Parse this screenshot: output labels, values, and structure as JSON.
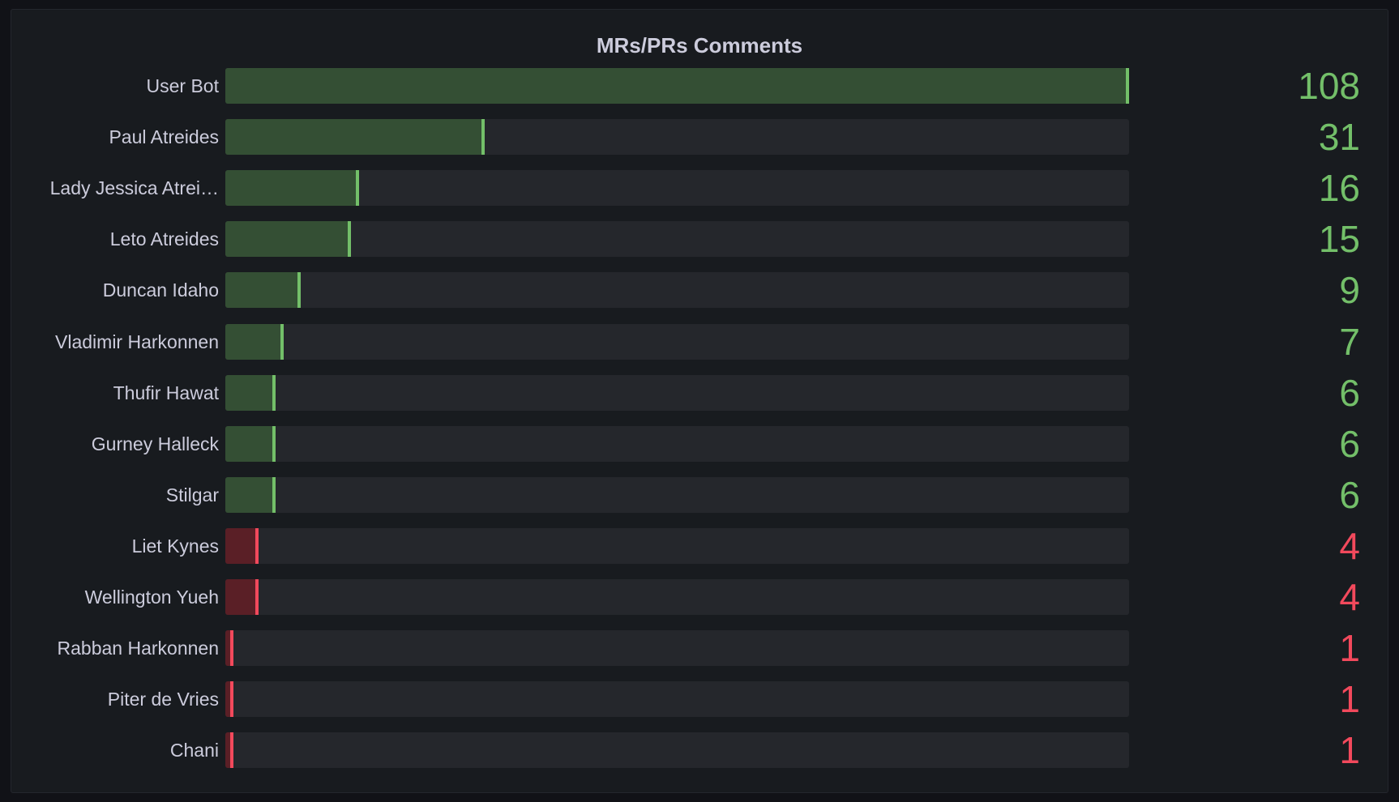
{
  "panel": {
    "title": "MRs/PRs Comments"
  },
  "colors": {
    "good_line": "#73bf69",
    "good_fill": "#344f34",
    "bad_line": "#f2495c",
    "bad_fill": "#5a1f26",
    "track": "#25272c"
  },
  "chart_data": {
    "type": "bar",
    "orientation": "horizontal",
    "title": "MRs/PRs Comments",
    "xlim": [
      0,
      108
    ],
    "threshold": 5,
    "categories": [
      "User Bot",
      "Paul Atreides",
      "Lady Jessica Atrei…",
      "Leto Atreides",
      "Duncan Idaho",
      "Vladimir Harkonnen",
      "Thufir Hawat",
      "Gurney Halleck",
      "Stilgar",
      "Liet Kynes",
      "Wellington Yueh",
      "Rabban Harkonnen",
      "Piter de Vries",
      "Chani"
    ],
    "values": [
      108,
      31,
      16,
      15,
      9,
      7,
      6,
      6,
      6,
      4,
      4,
      1,
      1,
      1
    ]
  }
}
